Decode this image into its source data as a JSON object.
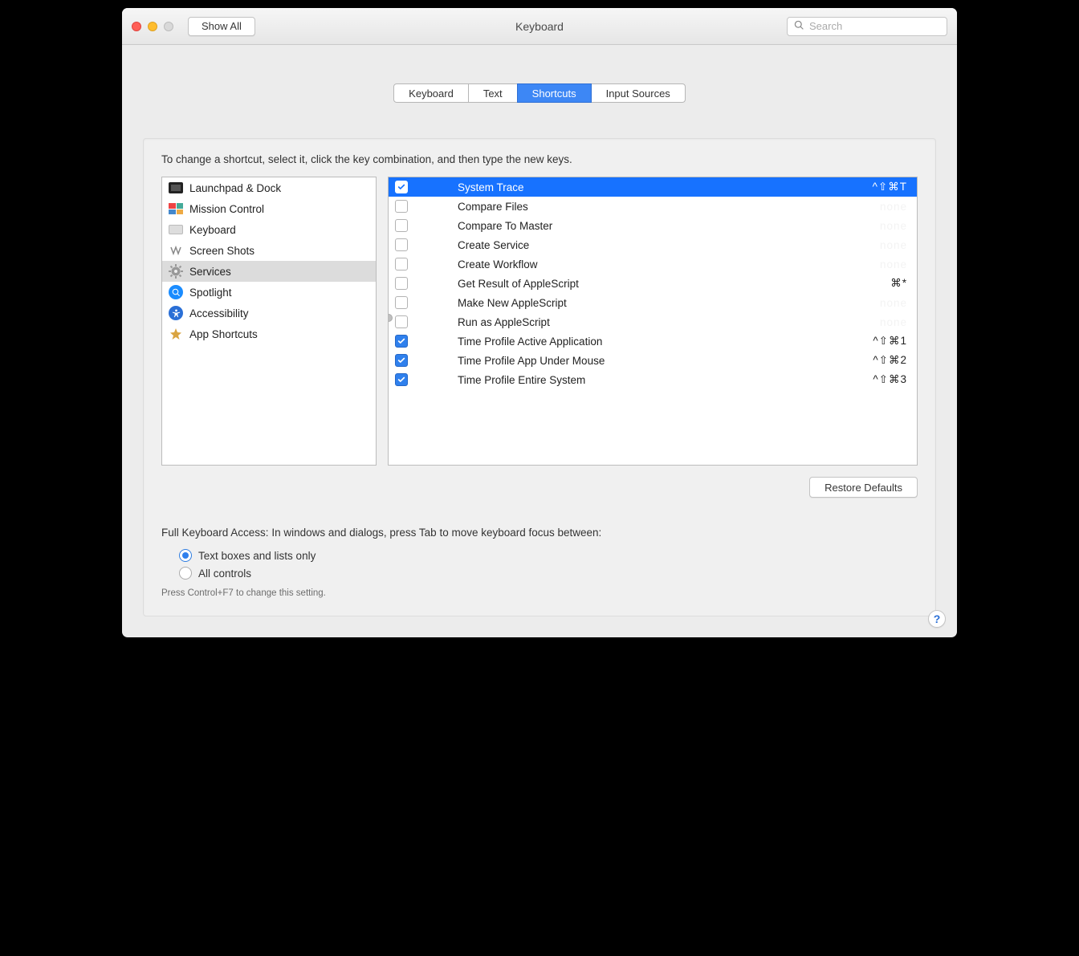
{
  "window": {
    "title": "Keyboard",
    "show_all": "Show All",
    "search_placeholder": "Search"
  },
  "tabs": [
    {
      "label": "Keyboard",
      "active": false
    },
    {
      "label": "Text",
      "active": false
    },
    {
      "label": "Shortcuts",
      "active": true
    },
    {
      "label": "Input Sources",
      "active": false
    }
  ],
  "instruction": "To change a shortcut, select it, click the key combination, and then type the new keys.",
  "categories": [
    {
      "label": "Launchpad & Dock",
      "icon": "launchpad",
      "selected": false
    },
    {
      "label": "Mission Control",
      "icon": "mission-control",
      "selected": false
    },
    {
      "label": "Keyboard",
      "icon": "keyboard",
      "selected": false
    },
    {
      "label": "Screen Shots",
      "icon": "screenshots",
      "selected": false
    },
    {
      "label": "Services",
      "icon": "services",
      "selected": true
    },
    {
      "label": "Spotlight",
      "icon": "spotlight",
      "selected": false
    },
    {
      "label": "Accessibility",
      "icon": "accessibility",
      "selected": false
    },
    {
      "label": "App Shortcuts",
      "icon": "app-shortcuts",
      "selected": false
    }
  ],
  "shortcuts": [
    {
      "checked": true,
      "label": "System Trace",
      "key": "^⇧⌘T",
      "selected": true
    },
    {
      "checked": false,
      "label": "Compare Files",
      "key": "none",
      "selected": false
    },
    {
      "checked": false,
      "label": "Compare To Master",
      "key": "none",
      "selected": false
    },
    {
      "checked": false,
      "label": "Create Service",
      "key": "none",
      "selected": false
    },
    {
      "checked": false,
      "label": "Create Workflow",
      "key": "none",
      "selected": false
    },
    {
      "checked": false,
      "label": "Get Result of AppleScript",
      "key": "⌘*",
      "selected": false
    },
    {
      "checked": false,
      "label": "Make New AppleScript",
      "key": "none",
      "selected": false
    },
    {
      "checked": false,
      "label": "Run as AppleScript",
      "key": "none",
      "selected": false
    },
    {
      "checked": true,
      "label": "Time Profile Active Application",
      "key": "^⇧⌘1",
      "selected": false
    },
    {
      "checked": true,
      "label": "Time Profile App Under Mouse",
      "key": "^⇧⌘2",
      "selected": false
    },
    {
      "checked": true,
      "label": "Time Profile Entire System",
      "key": "^⇧⌘3",
      "selected": false
    }
  ],
  "restore_defaults": "Restore Defaults",
  "fka": {
    "label": "Full Keyboard Access: In windows and dialogs, press Tab to move keyboard focus between:",
    "options": [
      {
        "label": "Text boxes and lists only",
        "checked": true
      },
      {
        "label": "All controls",
        "checked": false
      }
    ],
    "hint": "Press Control+F7 to change this setting."
  },
  "help": "?"
}
